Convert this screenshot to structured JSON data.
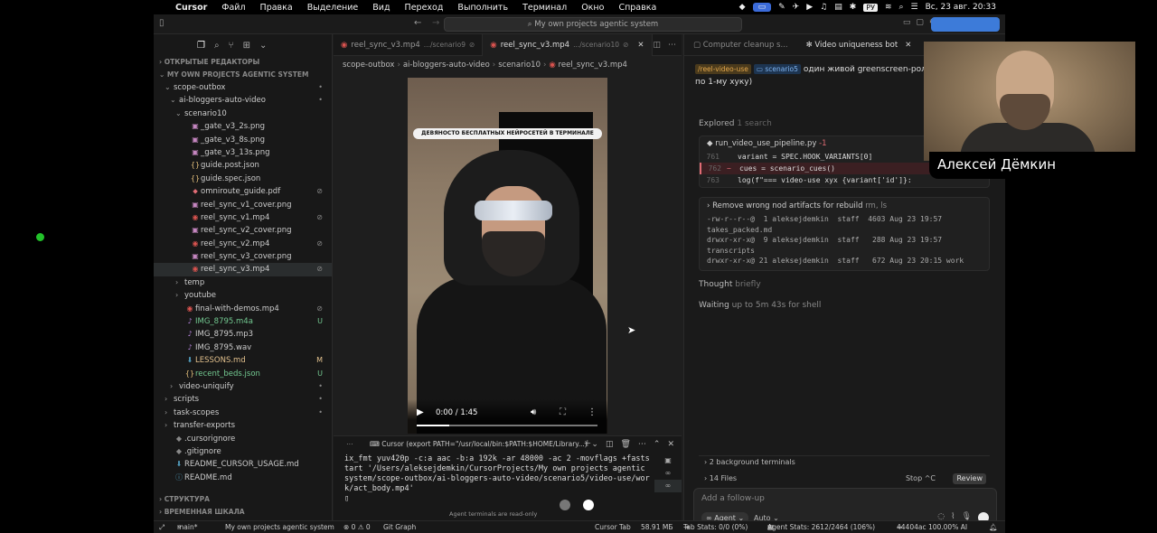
{
  "menubar": {
    "app": "Cursor",
    "items": [
      "Файл",
      "Правка",
      "Выделение",
      "Вид",
      "Переход",
      "Выполнить",
      "Терминал",
      "Окно",
      "Справка"
    ],
    "lang": "РУ",
    "datetime": "Вс, 23 авг.  20:33"
  },
  "titlebar": {
    "command_center": "My own projects agentic system"
  },
  "sidebar": {
    "open_editors": "ОТКРЫТЫЕ РЕДАКТОРЫ",
    "workspace": "MY OWN PROJECTS AGENTIC SYSTEM",
    "tree": [
      {
        "label": "scope-outbox",
        "indent": 0,
        "kind": "folder-open",
        "status": "•"
      },
      {
        "label": "ai-bloggers-auto-video",
        "indent": 1,
        "kind": "folder-open",
        "status": "•"
      },
      {
        "label": "scenario10",
        "indent": 2,
        "kind": "folder-open",
        "status": ""
      },
      {
        "label": "_gate_v3_2s.png",
        "indent": 3,
        "kind": "img",
        "status": ""
      },
      {
        "label": "_gate_v3_8s.png",
        "indent": 3,
        "kind": "img",
        "status": ""
      },
      {
        "label": "_gate_v3_13s.png",
        "indent": 3,
        "kind": "img",
        "status": ""
      },
      {
        "label": "guide.post.json",
        "indent": 3,
        "kind": "json",
        "status": ""
      },
      {
        "label": "guide.spec.json",
        "indent": 3,
        "kind": "json",
        "status": ""
      },
      {
        "label": "omniroute_guide.pdf",
        "indent": 3,
        "kind": "pdf",
        "status": "⊘"
      },
      {
        "label": "reel_sync_v1_cover.png",
        "indent": 3,
        "kind": "img",
        "status": ""
      },
      {
        "label": "reel_sync_v1.mp4",
        "indent": 3,
        "kind": "vid",
        "status": "⊘"
      },
      {
        "label": "reel_sync_v2_cover.png",
        "indent": 3,
        "kind": "img",
        "status": ""
      },
      {
        "label": "reel_sync_v2.mp4",
        "indent": 3,
        "kind": "vid",
        "status": "⊘"
      },
      {
        "label": "reel_sync_v3_cover.png",
        "indent": 3,
        "kind": "img",
        "status": ""
      },
      {
        "label": "reel_sync_v3.mp4",
        "indent": 3,
        "kind": "vid",
        "status": "⊘",
        "selected": true
      },
      {
        "label": "temp",
        "indent": 2,
        "kind": "folder",
        "status": ""
      },
      {
        "label": "youtube",
        "indent": 2,
        "kind": "folder",
        "status": ""
      },
      {
        "label": "final-with-demos.mp4",
        "indent": 2,
        "kind": "vid",
        "status": "⊘"
      },
      {
        "label": "IMG_8795.m4a",
        "indent": 2,
        "kind": "aud",
        "status": "U"
      },
      {
        "label": "IMG_8795.mp3",
        "indent": 2,
        "kind": "aud",
        "status": ""
      },
      {
        "label": "IMG_8795.wav",
        "indent": 2,
        "kind": "aud",
        "status": ""
      },
      {
        "label": "LESSONS.md",
        "indent": 2,
        "kind": "md",
        "status": "M"
      },
      {
        "label": "recent_beds.json",
        "indent": 2,
        "kind": "json",
        "status": "U"
      },
      {
        "label": "video-uniquify",
        "indent": 1,
        "kind": "folder",
        "status": "•"
      },
      {
        "label": "scripts",
        "indent": 0,
        "kind": "folder",
        "status": "•"
      },
      {
        "label": "task-scopes",
        "indent": 0,
        "kind": "folder",
        "status": "•"
      },
      {
        "label": "transfer-exports",
        "indent": 0,
        "kind": "folder",
        "status": ""
      },
      {
        "label": ".cursorignore",
        "indent": 0,
        "kind": "git",
        "status": ""
      },
      {
        "label": ".gitignore",
        "indent": 0,
        "kind": "git",
        "status": ""
      },
      {
        "label": "README_CURSOR_USAGE.md",
        "indent": 0,
        "kind": "md",
        "status": ""
      },
      {
        "label": "README.md",
        "indent": 0,
        "kind": "info",
        "status": ""
      }
    ],
    "outline": "СТРУКТУРА",
    "timeline": "ВРЕМЕННАЯ ШКАЛА"
  },
  "editor": {
    "tabs": [
      {
        "name": "reel_sync_v3.mp4",
        "path": ".../scenario9"
      },
      {
        "name": "reel_sync_v3.mp4",
        "path": ".../scenario10"
      }
    ],
    "breadcrumb": [
      "scope-outbox",
      "ai-bloggers-auto-video",
      "scenario10",
      "reel_sync_v3.mp4"
    ],
    "video": {
      "caption": "ДЕВЯНОСТО БЕСПЛАТНЫХ НЕЙРОСЕТЕЙ В ТЕРМИНАЛЕ",
      "time": "0:00 / 1:45",
      "progress": 0.18
    }
  },
  "terminal": {
    "title": "Cursor (export PATH=\"/usr/local/bin:$PATH:$HOME/Library...)",
    "output": "ix_fmt yuv420p -c:a aac -b:a 192k -ar 48000 -ac 2 -movflags +faststart '/Users/aleksejdemkin/CursorProjects/My own projects agentic system/scope-outbox/ai-bloggers-auto-video/scenario5/video-use/work/act_body.mp4'",
    "readonly": "Agent terminals are read-only"
  },
  "agent": {
    "tabs": [
      "Computer cleanup s...",
      "Video uniqueness bot"
    ],
    "user_message": {
      "chip1": "/reel-video-use",
      "chip2": "scenario5",
      "text": "один живой greenscreen-ролик по 1-му хуку)"
    },
    "explored": "Explored",
    "explored_detail": "1 search",
    "code": {
      "file": "run_video_use_pipeline.py",
      "diff": "-1",
      "lines": [
        {
          "n": "761",
          "mark": "",
          "code": "variant = SPEC.HOOK_VARIANTS[0]",
          "del": false
        },
        {
          "n": "762",
          "mark": "−",
          "code": "cues = scenario_cues()",
          "del": true
        },
        {
          "n": "763",
          "mark": "",
          "code": "log(f\"=== video-use xyx {variant['id']}:",
          "del": false
        }
      ]
    },
    "command": {
      "title": "Remove wrong nod artifacts for rebuild",
      "detail": "rm, ls",
      "output": "-rw-r--r--@  1 aleksejdemkin  staff  4603 Aug 23 19:57\ntakes_packed.md\ndrwxr-xr-x@  9 aleksejdemkin  staff   288 Aug 23 19:57\ntranscripts\ndrwxr-xr-x@ 21 aleksejdemkin  staff   672 Aug 23 20:15 work"
    },
    "thought": "Thought",
    "thought_detail": "briefly",
    "waiting": "Waiting",
    "waiting_detail": "up to 5m 43s for shell",
    "bg_terminals": "2 background terminals",
    "files": "14 Files",
    "stop": "Stop ^C",
    "review": "Review",
    "placeholder": "Add a follow-up",
    "mode": "Agent",
    "model": "Auto"
  },
  "statusbar": {
    "branch": "main*",
    "workspace": "My own projects agentic system",
    "problems": "⊗ 0 ⚠ 0",
    "git_graph": "Git Graph",
    "cursor_tab": "Cursor Tab",
    "memory": "58.91 МБ",
    "tab_stats": "Tab Stats: 0/0 (0%)",
    "agent_stats": "Agent Stats: 2612/2464 (106%)",
    "commit": "44404ac 100.00% AI"
  },
  "webcam": {
    "name": "Алексей Дёмкин"
  }
}
